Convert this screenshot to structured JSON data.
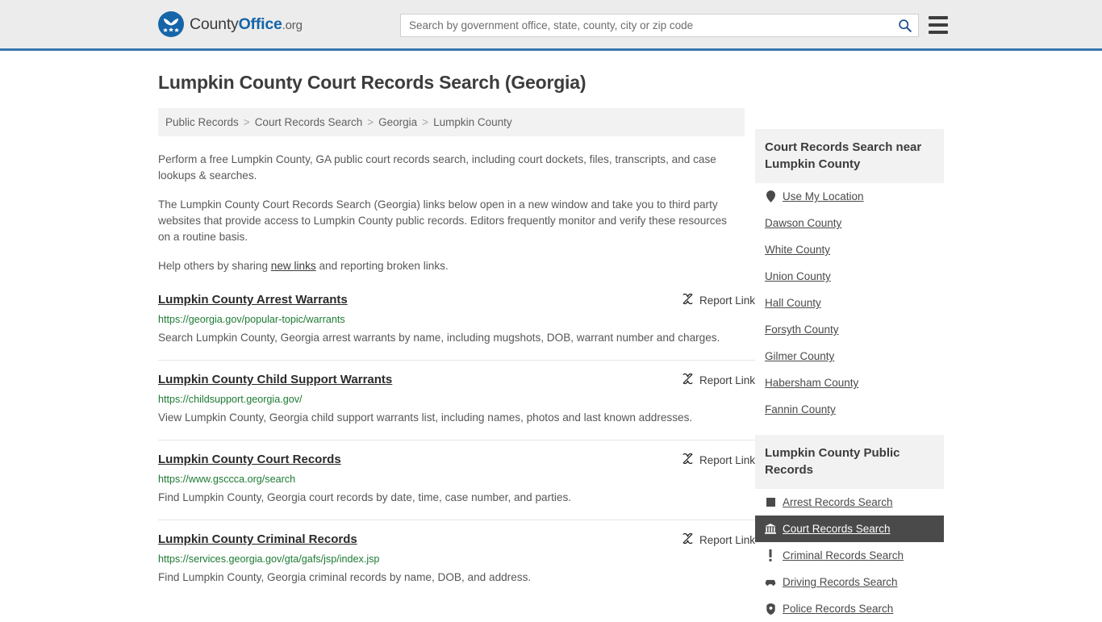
{
  "header": {
    "logo_text_county": "County",
    "logo_text_office": "Office",
    "logo_text_org": ".org",
    "logo_icon": "county-office-eagle-logo",
    "search_placeholder": "Search by government office, state, county, city or zip code",
    "search_value": "",
    "search_icon": "search-icon",
    "menu_icon": "hamburger-menu-icon",
    "accent_color": "#3a77ad",
    "background_color": "#ececec"
  },
  "main": {
    "title": "Lumpkin County Court Records Search (Georgia)",
    "breadcrumb": [
      "Public Records",
      "Court Records Search",
      "Georgia",
      "Lumpkin County"
    ],
    "breadcrumb_separator": ">",
    "intro": {
      "p1": "Perform a free Lumpkin County, GA public court records search, including court dockets, files, transcripts, and case lookups & searches.",
      "p2": "The Lumpkin County Court Records Search (Georgia) links below open in a new window and take you to third party websites that provide access to Lumpkin County public records. Editors frequently monitor and verify these resources on a routine basis.",
      "p3_before": "Help others by sharing ",
      "p3_link": "new links",
      "p3_after": " and reporting broken links."
    },
    "report_link_label": "Report Link",
    "report_link_icon": "broken-link-icon",
    "url_color": "#1d7a33",
    "results": [
      {
        "title": "Lumpkin County Arrest Warrants",
        "url": "https://georgia.gov/popular-topic/warrants",
        "description": "Search Lumpkin County, Georgia arrest warrants by name, including mugshots, DOB, warrant number and charges."
      },
      {
        "title": "Lumpkin County Child Support Warrants",
        "url": "https://childsupport.georgia.gov/",
        "description": "View Lumpkin County, Georgia child support warrants list, including names, photos and last known addresses."
      },
      {
        "title": "Lumpkin County Court Records",
        "url": "https://www.gsccca.org/search",
        "description": "Find Lumpkin County, Georgia court records by date, time, case number, and parties."
      },
      {
        "title": "Lumpkin County Criminal Records",
        "url": "https://services.georgia.gov/gta/gafs/jsp/index.jsp",
        "description": "Find Lumpkin County, Georgia criminal records by name, DOB, and address."
      }
    ]
  },
  "sidebar": {
    "nearby_panel": {
      "heading": "Court Records Search near Lumpkin County",
      "items": [
        {
          "label": "Use My Location",
          "icon": "map-pin-icon"
        },
        {
          "label": "Dawson County",
          "icon": ""
        },
        {
          "label": "White County",
          "icon": ""
        },
        {
          "label": "Union County",
          "icon": ""
        },
        {
          "label": "Hall County",
          "icon": ""
        },
        {
          "label": "Forsyth County",
          "icon": ""
        },
        {
          "label": "Gilmer County",
          "icon": ""
        },
        {
          "label": "Habersham County",
          "icon": ""
        },
        {
          "label": "Fannin County",
          "icon": ""
        }
      ]
    },
    "records_panel": {
      "heading": "Lumpkin County Public Records",
      "items": [
        {
          "label": "Arrest Records Search",
          "icon": "handcuffs-icon",
          "active": false
        },
        {
          "label": "Court Records Search",
          "icon": "courthouse-icon",
          "active": true
        },
        {
          "label": "Criminal Records Search",
          "icon": "exclamation-icon",
          "active": false
        },
        {
          "label": "Driving Records Search",
          "icon": "car-icon",
          "active": false
        },
        {
          "label": "Police Records Search",
          "icon": "police-badge-icon",
          "active": false
        }
      ],
      "active_background": "#4a4a4a"
    }
  }
}
